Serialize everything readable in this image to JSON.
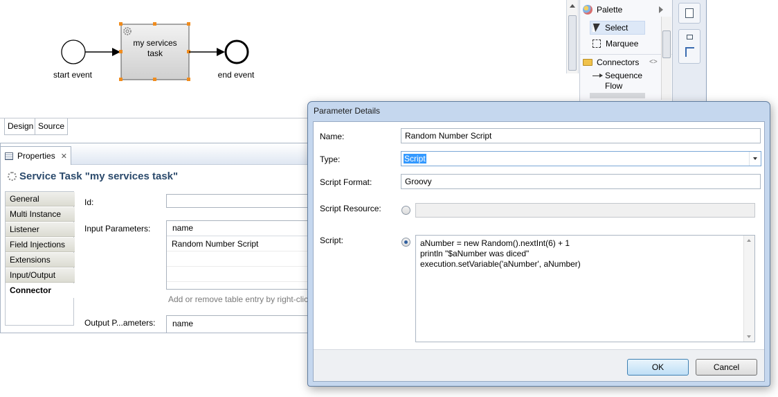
{
  "diagram": {
    "start_label": "start event",
    "task_label_line1": "my services",
    "task_label_line2": "task",
    "end_label": "end event"
  },
  "palette": {
    "title": "Palette",
    "select": "Select",
    "marquee": "Marquee",
    "connectors": "Connectors",
    "sequence_line1": "Sequence",
    "sequence_line2": "Flow"
  },
  "editor_tabs": {
    "design": "Design",
    "source": "Source"
  },
  "properties": {
    "view_tab": "Properties",
    "header_title": "Service Task \"my services task\"",
    "sidebar": [
      "General",
      "Multi Instance",
      "Listener",
      "Field Injections",
      "Extensions",
      "Input/Output",
      "Connector"
    ],
    "active_index": 6,
    "id_label": "Id:",
    "input_params_label": "Input Parameters:",
    "table_header": "name",
    "table_rows": [
      "Random Number Script"
    ],
    "hint": "Add or remove table entry by right-click",
    "output_params_label": "Output P...ameters:",
    "output_table_header": "name"
  },
  "dialog": {
    "title": "Parameter Details",
    "name_label": "Name:",
    "name_value": "Random Number Script",
    "type_label": "Type:",
    "type_value": "Script",
    "format_label": "Script Format:",
    "format_value": "Groovy",
    "resource_label": "Script Resource:",
    "script_label": "Script:",
    "script_lines": [
      "aNumber = new Random().nextInt(6) + 1",
      "println \"$aNumber was diced\"",
      "execution.setVariable('aNumber', aNumber)"
    ],
    "ok": "OK",
    "cancel": "Cancel"
  },
  "colors": {
    "selection_handle": "#f08c1e",
    "task_fill": "#dcdcdc",
    "header_title": "#2b4a6c"
  }
}
